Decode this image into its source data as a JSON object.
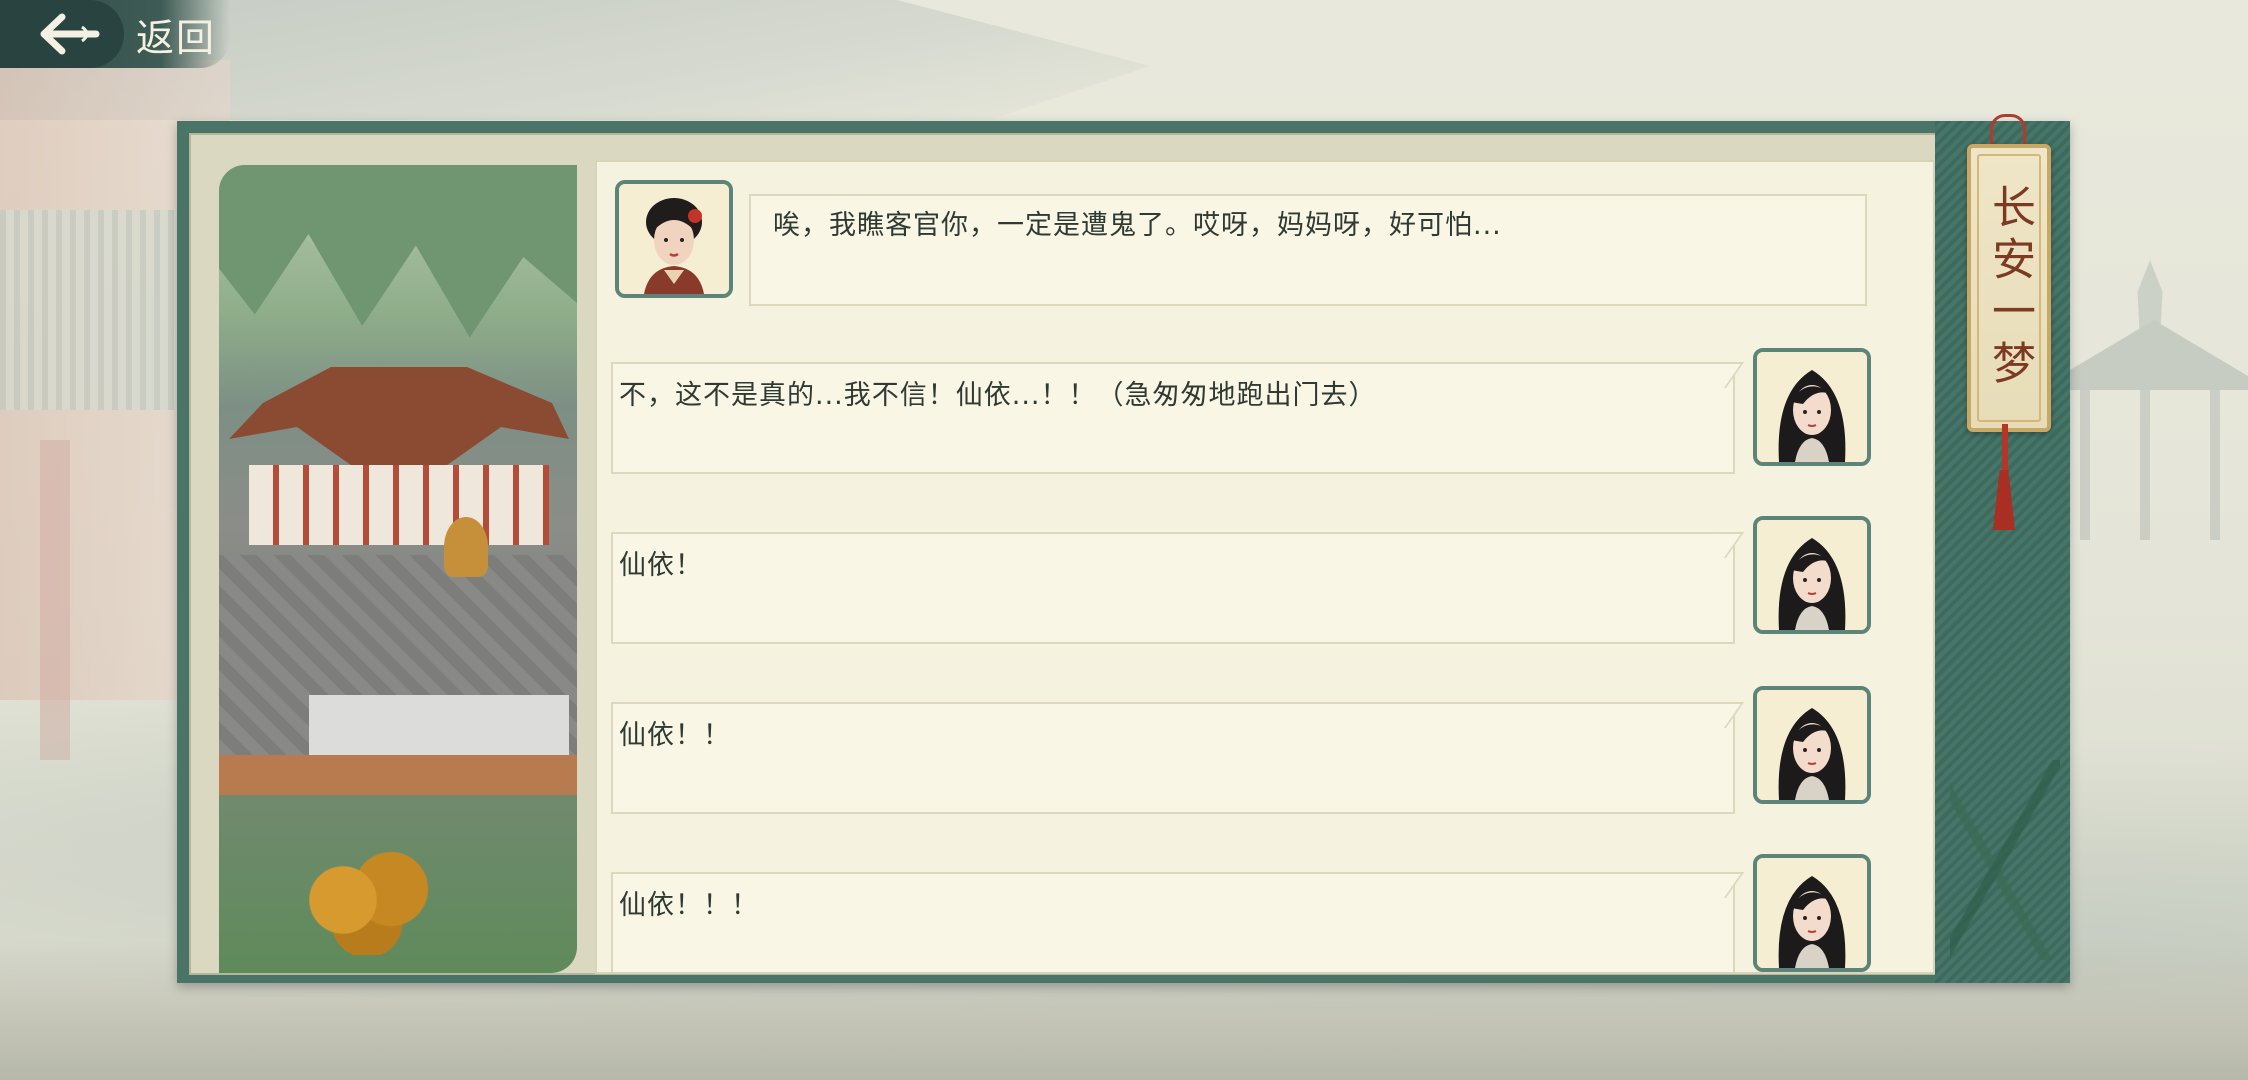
{
  "header": {
    "back_label": "返回"
  },
  "title": "长安一梦",
  "dialogue": [
    {
      "side": "left",
      "speaker_icon": "woman-red-hairpin-portrait-icon",
      "text": "唉，我瞧客官你，一定是遭鬼了。哎呀，妈妈呀，好可怕..."
    },
    {
      "side": "right",
      "speaker_icon": "heroine-portrait-icon",
      "text": "不，这不是真的...我不信！仙依...！！（急匆匆地跑出门去）"
    },
    {
      "side": "right",
      "speaker_icon": "heroine-portrait-icon",
      "text": "仙依！"
    },
    {
      "side": "right",
      "speaker_icon": "heroine-portrait-icon",
      "text": "仙依！！"
    },
    {
      "side": "right",
      "speaker_icon": "heroine-portrait-icon",
      "text": "仙依！！！"
    }
  ],
  "colors": {
    "panel_frame": "#4a7468",
    "panel_bg": "#f6f2e0",
    "title_text": "#7c3a22",
    "back_button": "#294440"
  }
}
